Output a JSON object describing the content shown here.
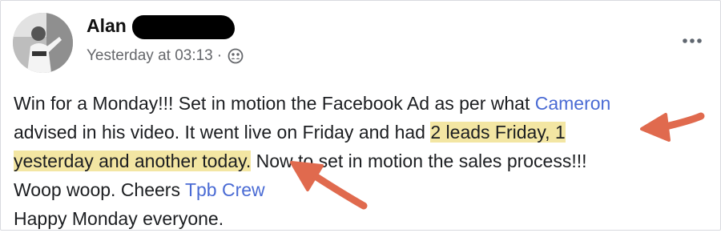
{
  "post": {
    "author": "Alan",
    "timestamp": "Yesterday at 03:13",
    "separator": "·",
    "privacy_icon": "friends-icon",
    "more_icon": "more-options-icon",
    "lines": [
      {
        "pre": "Win for a Monday!!! Set in motion the Facebook Ad as per what ",
        "link": "Cameron"
      },
      {
        "pre": "advised in his video. It went live on Friday and had ",
        "highlight": "2 leads Friday, 1"
      },
      {
        "highlight": "yesterday and another today.",
        "post": " Now to set in motion the sales process!!!"
      },
      {
        "pre": "Woop woop. Cheers ",
        "link": "Tpb Crew"
      },
      {
        "pre": "Happy Monday everyone."
      }
    ]
  },
  "colors": {
    "link": "#4a6bd4",
    "highlight": "#f3e6a3",
    "arrow": "#e06a4e",
    "meta_text": "#65676b"
  }
}
